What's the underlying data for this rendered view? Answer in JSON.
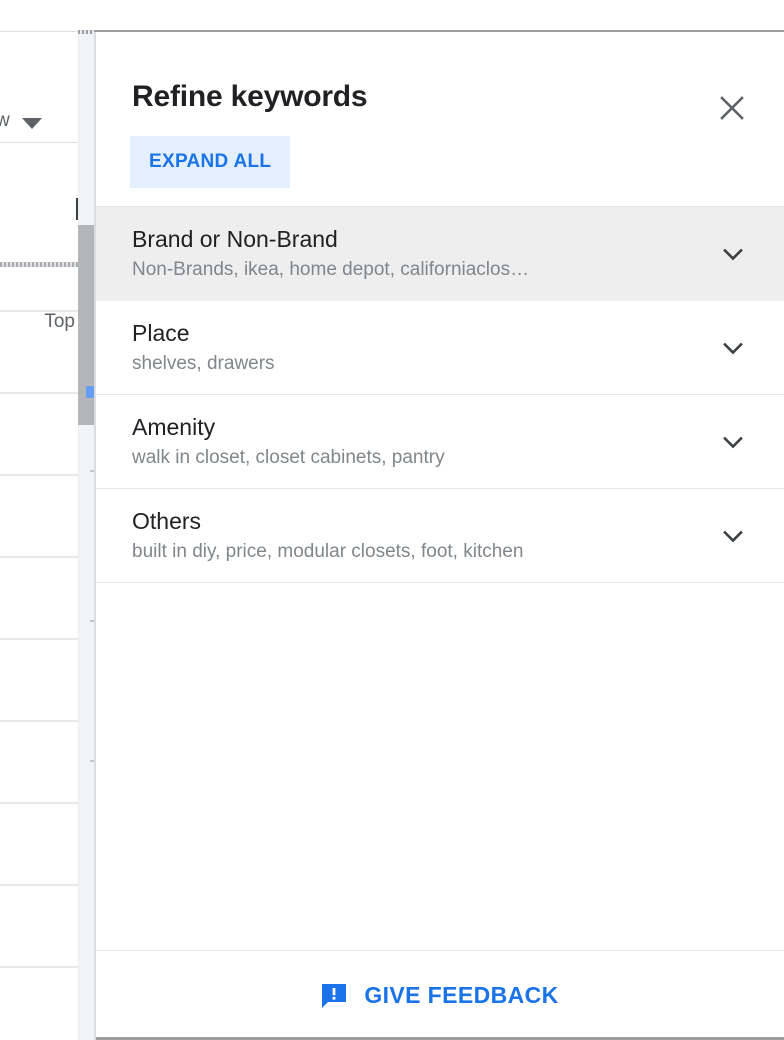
{
  "background": {
    "dropdown_letter": "w",
    "dropdown_caret_icon": "caret-down-icon",
    "column_header": "Top",
    "scrollbar": "vertical-scrollbar"
  },
  "panel": {
    "title": "Refine keywords",
    "close_icon": "close-icon",
    "expand_all_label": "EXPAND ALL",
    "accent_color": "#1a73e8",
    "expand_all_bg": "#e3effd",
    "focus_border_color": "#669df6",
    "hover_bg": "#eeeeee",
    "items": [
      {
        "title": "Brand or Non-Brand",
        "subtitle": "Non-Brands, ikea, home depot, californiaclos…",
        "chevron_icon": "chevron-down-icon",
        "hovered": true,
        "focused": true
      },
      {
        "title": "Place",
        "subtitle": "shelves, drawers",
        "chevron_icon": "chevron-down-icon",
        "hovered": false,
        "focused": false
      },
      {
        "title": "Amenity",
        "subtitle": "walk in closet, closet cabinets, pantry",
        "chevron_icon": "chevron-down-icon",
        "hovered": false,
        "focused": false
      },
      {
        "title": "Others",
        "subtitle": "built in diy, price, modular closets, foot, kitchen",
        "chevron_icon": "chevron-down-icon",
        "hovered": false,
        "focused": false
      }
    ],
    "footer": {
      "feedback_label": "GIVE FEEDBACK",
      "feedback_icon": "feedback-speech-bubble-icon"
    }
  }
}
